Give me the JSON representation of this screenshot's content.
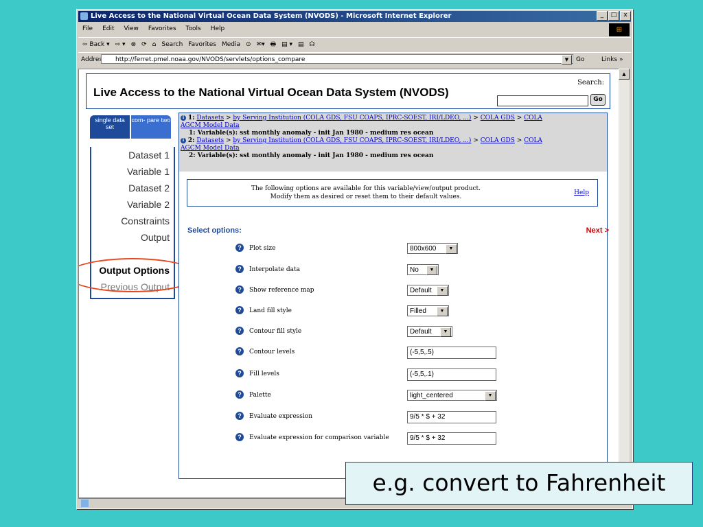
{
  "window": {
    "title": "Live Access to the National Virtual Ocean Data System (NVODS) - Microsoft Internet Explorer",
    "buttons": [
      "_",
      "□",
      "x"
    ]
  },
  "menubar": [
    "File",
    "Edit",
    "View",
    "Favorites",
    "Tools",
    "Help"
  ],
  "toolbar": [
    "⇦ Back ▾",
    "⇨ ▾",
    "⊗",
    "⟳",
    "⌂",
    "Search",
    "Favorites",
    "Media",
    "⊙",
    "✉▾",
    "🖶",
    "▤ ▾",
    "▤",
    "☊"
  ],
  "address": {
    "label": "Address",
    "url": "http://ferret.pmel.noaa.gov/NVODS/servlets/options_compare",
    "go_label": "Go",
    "links_label": "Links »"
  },
  "page": {
    "title": "Live Access to the National Virtual Ocean Data System (NVODS)",
    "search_label": "Search:",
    "search_go": "Go",
    "tabs": [
      {
        "label": "single data set"
      },
      {
        "label": "com- pare two"
      }
    ],
    "nav": [
      {
        "label": "Dataset 1"
      },
      {
        "label": "Variable 1"
      },
      {
        "label": "Dataset 2"
      },
      {
        "label": "Variable 2"
      },
      {
        "label": "Constraints"
      },
      {
        "label": "Output"
      },
      {
        "label": "Output Options"
      },
      {
        "label": "Previous Output"
      }
    ],
    "crumbs": {
      "one_num": "1:",
      "two_num": "2:",
      "datasets": "Datasets",
      "institution": "by Serving Institution (COLA GDS, FSU COAPS, IPRC-SOEST, IRI/LDEO, ...)",
      "cola_gds": "COLA GDS",
      "cola": "COLA",
      "agcm": "AGCM Model Data",
      "sep": ">",
      "var1": "1: Variable(s): sst monthly anomaly - init Jan 1980 - medium res ocean",
      "var2": "2: Variable(s): sst monthly anomaly - init Jan 1980 - medium res ocean"
    },
    "note_line1": "The following options are available for this variable/view/output product.",
    "note_line2": "Modify them as desired or reset them to their default values.",
    "help": "Help",
    "select_options": "Select options:",
    "next": "Next >",
    "options": [
      {
        "label": "Plot size",
        "value": "800x600",
        "kind": "select"
      },
      {
        "label": "Interpolate data",
        "value": "No",
        "kind": "select"
      },
      {
        "label": "Show reference map",
        "value": "Default",
        "kind": "select"
      },
      {
        "label": "Land fill style",
        "value": "Filled",
        "kind": "select"
      },
      {
        "label": "Contour fill style",
        "value": "Default",
        "kind": "select"
      },
      {
        "label": "Contour levels",
        "value": "(-5,5,.5)",
        "kind": "text"
      },
      {
        "label": "Fill levels",
        "value": "(-5,5,.1)",
        "kind": "text"
      },
      {
        "label": "Palette",
        "value": "light_centered",
        "kind": "select"
      },
      {
        "label": "Evaluate expression",
        "value": "9/5 * $ + 32",
        "kind": "text"
      },
      {
        "label": "Evaluate expression for comparison variable",
        "value": "9/5 * $ + 32",
        "kind": "text"
      }
    ]
  },
  "caption": "e.g. convert to Fahrenheit",
  "colors": {
    "slide_bg": "#3ec9c9",
    "nav_blue": "#1f4a99",
    "highlight": "#e8461c",
    "next_red": "#cc0000"
  }
}
